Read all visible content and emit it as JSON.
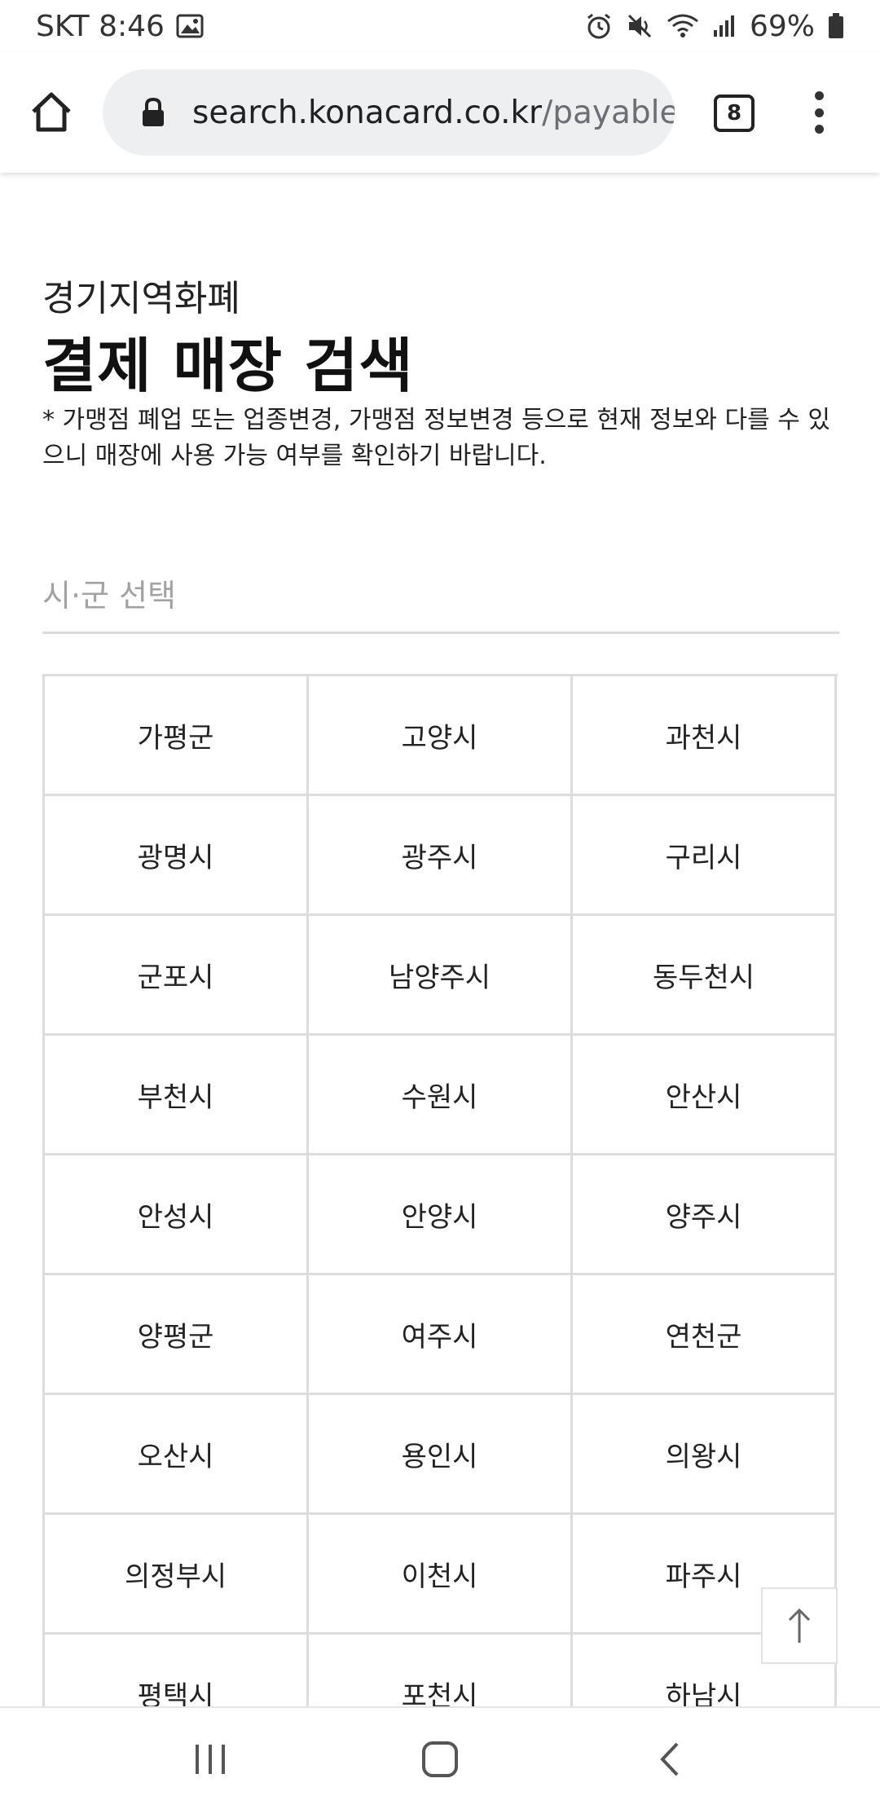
{
  "status_bar": {
    "carrier_time": "SKT 8:46",
    "battery": "69%",
    "icons": [
      "gallery-icon",
      "alarm-icon",
      "mute-icon",
      "wifi-icon",
      "signal-icon",
      "battery-icon"
    ]
  },
  "browser": {
    "url_host": "search.konacard.co.kr",
    "url_path": "/payable",
    "tab_count": "8"
  },
  "page": {
    "region": "경기지역화폐",
    "title": "결제 매장 검색",
    "notice": "* 가맹점 폐업 또는 업종변경, 가맹점 정보변경 등으로 현재 정보와 다를 수 있으니 매장에 사용 가능 여부를 확인하기 바랍니다.",
    "select_placeholder": "시·군 선택",
    "cities": [
      "가평군",
      "고양시",
      "과천시",
      "광명시",
      "광주시",
      "구리시",
      "군포시",
      "남양주시",
      "동두천시",
      "부천시",
      "수원시",
      "안산시",
      "안성시",
      "안양시",
      "양주시",
      "양평군",
      "여주시",
      "연천군",
      "오산시",
      "용인시",
      "의왕시",
      "의정부시",
      "이천시",
      "파주시",
      "평택시",
      "포천시",
      "하남시"
    ]
  }
}
